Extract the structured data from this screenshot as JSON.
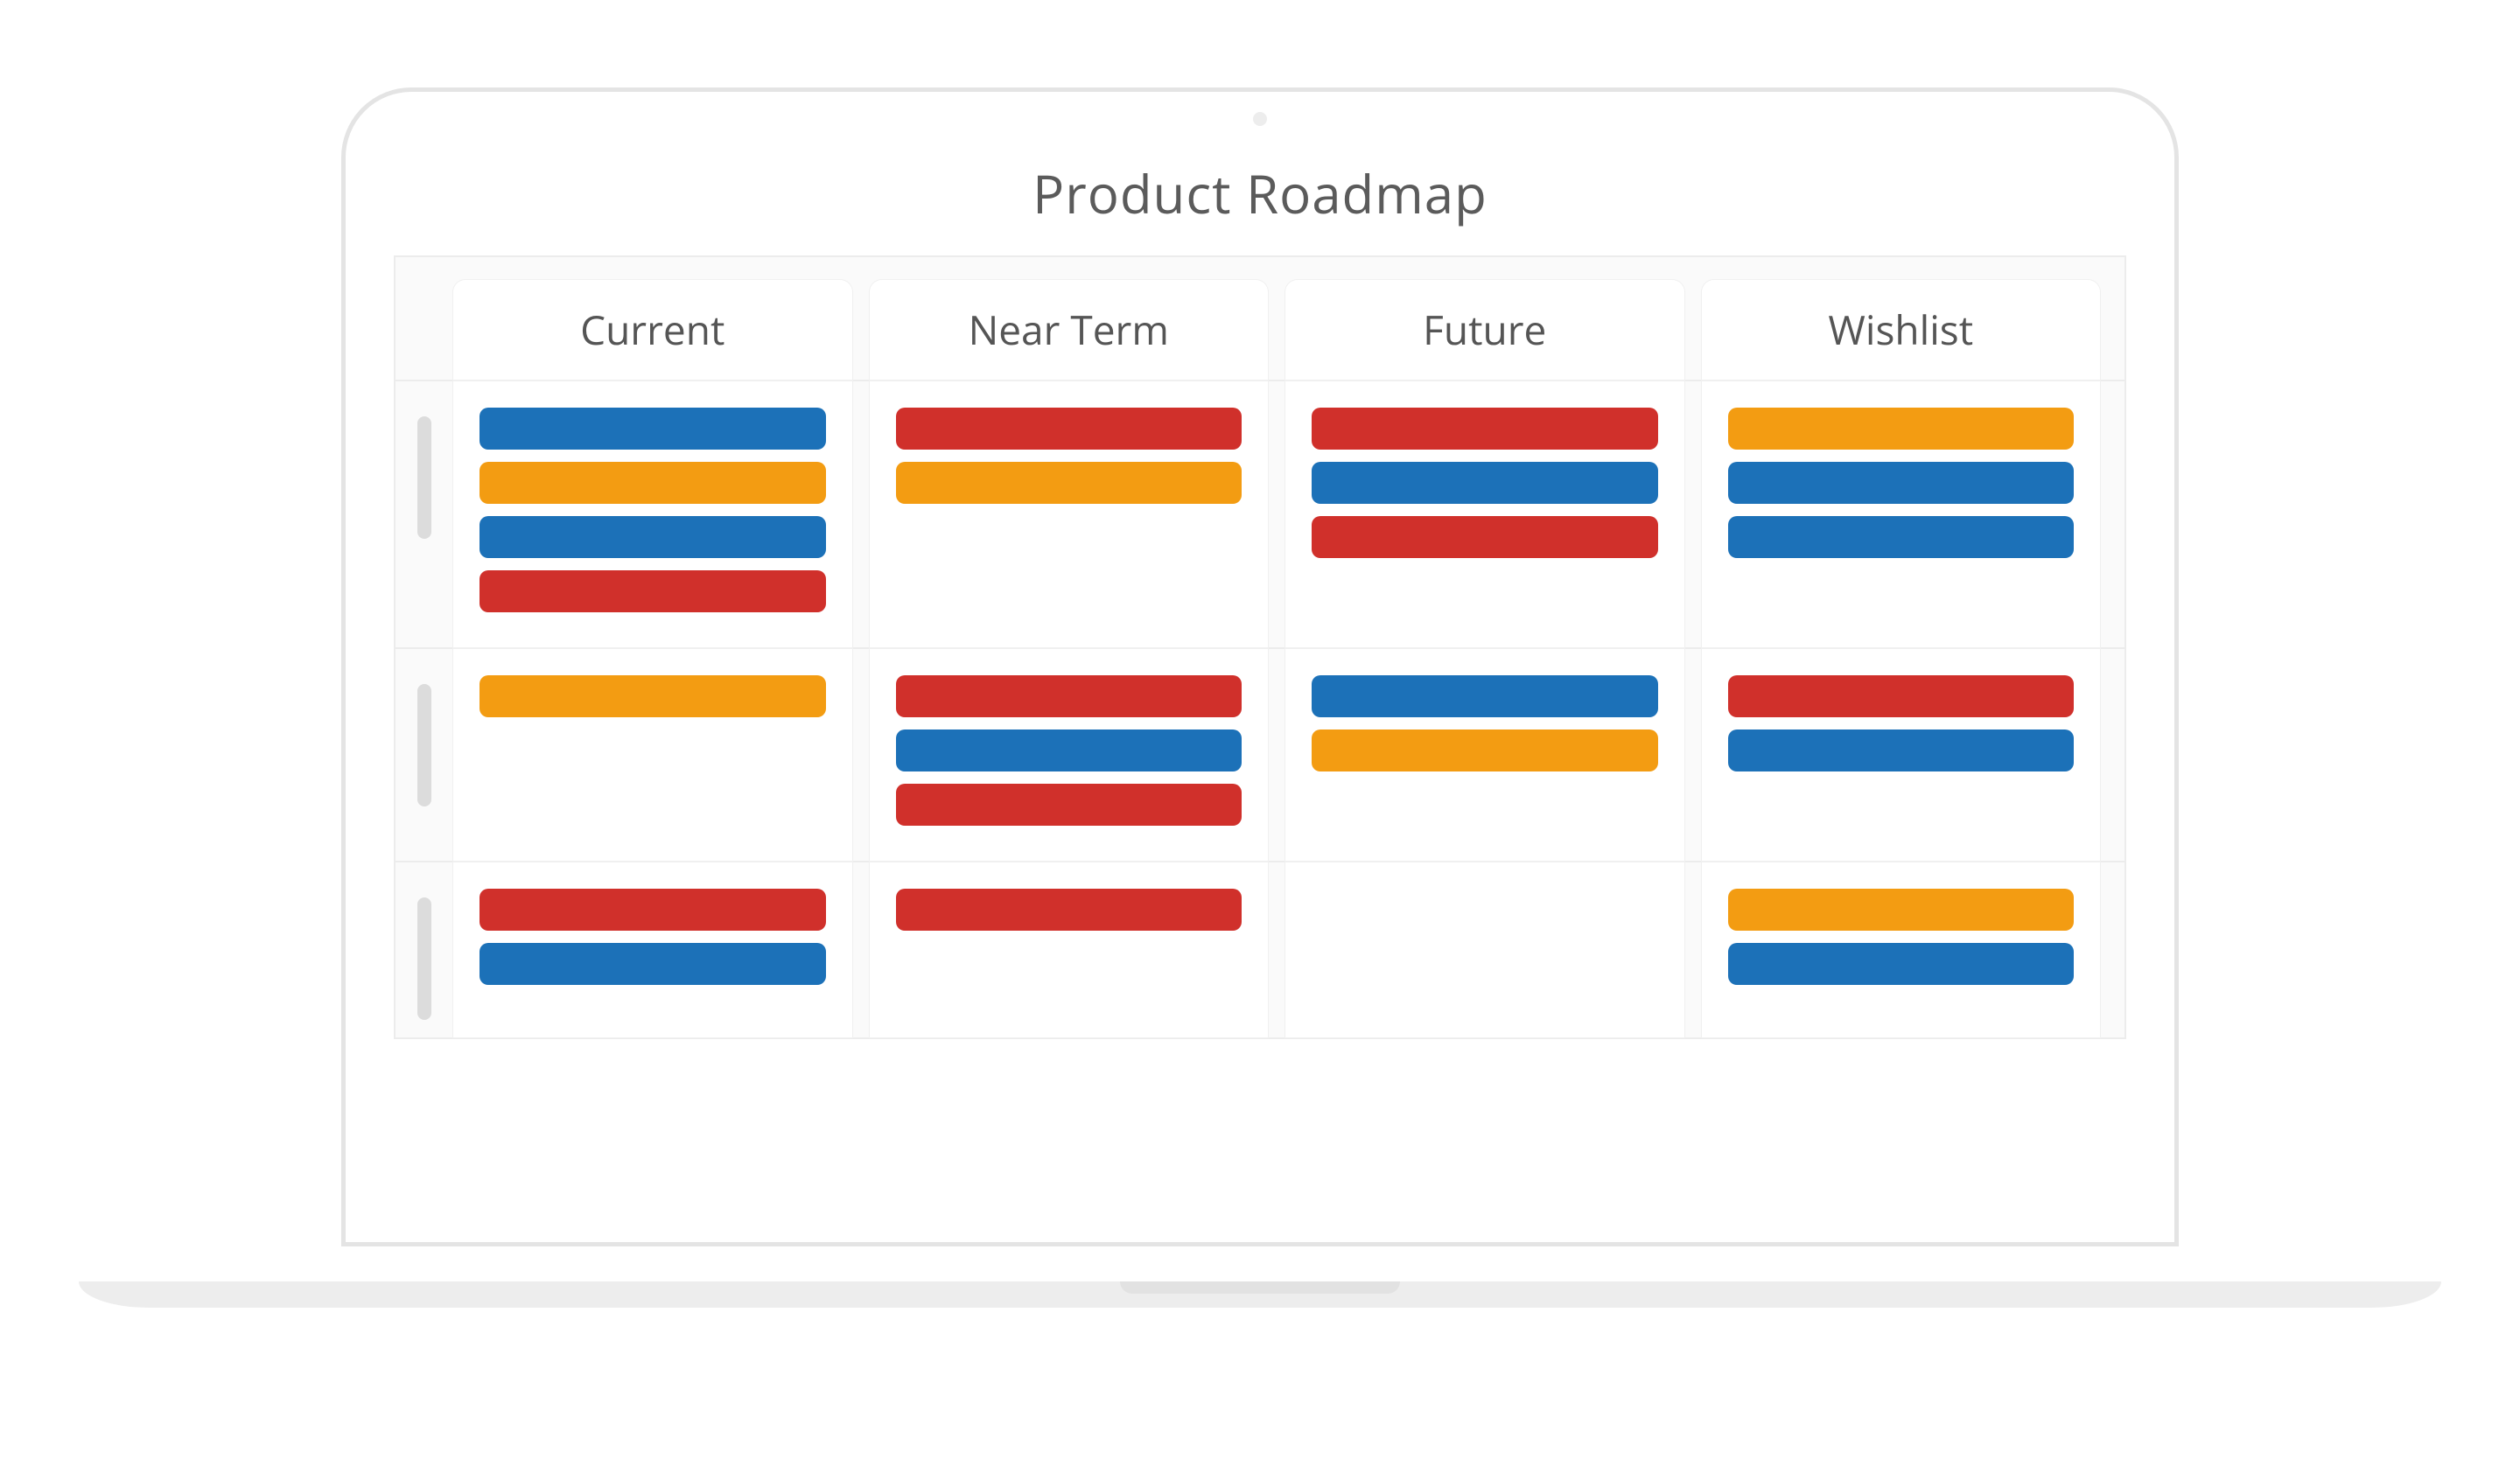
{
  "title": "Product Roadmap",
  "colors": {
    "blue": "#1c71b8",
    "orange": "#f39c12",
    "red": "#d0302b"
  },
  "columns": [
    {
      "label": "Current"
    },
    {
      "label": "Near Term"
    },
    {
      "label": "Future"
    },
    {
      "label": "Wishlist"
    }
  ],
  "rows": [
    {
      "cells": [
        [
          "blue",
          "orange",
          "blue",
          "red"
        ],
        [
          "red",
          "orange"
        ],
        [
          "red",
          "blue",
          "red"
        ],
        [
          "orange",
          "blue",
          "blue"
        ]
      ]
    },
    {
      "cells": [
        [
          "orange"
        ],
        [
          "red",
          "blue",
          "red"
        ],
        [
          "blue",
          "orange"
        ],
        [
          "red",
          "blue"
        ]
      ]
    },
    {
      "cells": [
        [
          "red",
          "blue"
        ],
        [
          "red"
        ],
        [],
        [
          "orange",
          "blue"
        ]
      ]
    }
  ]
}
